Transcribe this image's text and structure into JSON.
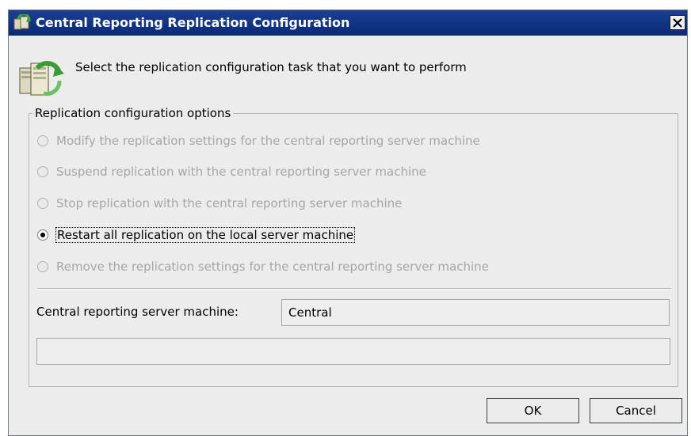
{
  "window": {
    "title": "Central Reporting Replication Configuration",
    "close_symbol": "X"
  },
  "prompt": "Select the replication configuration task that you want to perform",
  "group": {
    "legend": "Replication configuration options",
    "options": [
      {
        "label": "Modify the replication settings for the central reporting server machine",
        "enabled": false,
        "selected": false
      },
      {
        "label": "Suspend replication with the central reporting server machine",
        "enabled": false,
        "selected": false
      },
      {
        "label": "Stop replication with the central reporting server machine",
        "enabled": false,
        "selected": false
      },
      {
        "label": "Restart all replication on the local server machine",
        "enabled": true,
        "selected": true
      },
      {
        "label": "Remove the replication settings for the central reporting server machine",
        "enabled": false,
        "selected": false
      }
    ],
    "server_label": "Central reporting server machine:",
    "server_value": "Central",
    "status_value": ""
  },
  "buttons": {
    "ok": "OK",
    "cancel": "Cancel"
  },
  "icons": {
    "app": "replication-app-icon",
    "task": "servers-replication-icon",
    "close": "close-icon"
  },
  "colors": {
    "title_bar": "#0a2a78",
    "dialog_bg": "#ececec",
    "disabled_text": "#a6a6a6"
  }
}
